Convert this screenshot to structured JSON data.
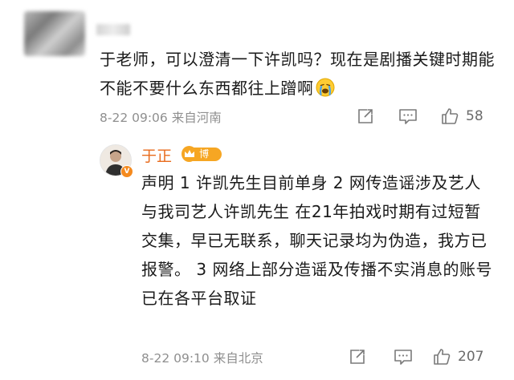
{
  "comment": {
    "text": "于老师，可以澄清一下许凯吗？现在是剧播关键时期能不能不要什么东西都往上蹭啊",
    "emoji": "crying-face-icon",
    "time": "8-22 09:06",
    "location": "来自河南",
    "likes": "58"
  },
  "reply": {
    "author": "于正",
    "badge": "博主",
    "text": "声明 1 许凯先生目前单身 2 网传造谣涉及艺人与我司艺人许凯先生 在21年拍戏时期有过短暂交集，早已无联系，聊天记录均为伪造，我方已报警。 3 网络上部分造谣及传播不实消息的账号已在各平台取证",
    "time": "8-22 09:10",
    "location": "来自北京",
    "likes": "207"
  },
  "colors": {
    "author_orange": "#e86b1c",
    "badge_gold": "#f6a623",
    "meta_gray": "#8f8f8f"
  }
}
